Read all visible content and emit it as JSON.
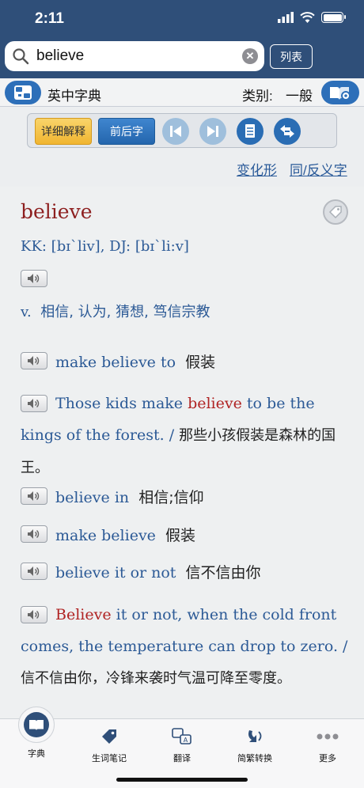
{
  "status": {
    "time": "2:11"
  },
  "search": {
    "value": "believe",
    "list_label": "列表"
  },
  "dict": {
    "title": "英中字典",
    "category_label": "类别:",
    "category_value": "一般"
  },
  "toolbar": {
    "detail_label": "详细解释",
    "nearby_label": "前后字"
  },
  "links": {
    "inflection": "变化形",
    "synonyms": "同/反义字"
  },
  "entry": {
    "headword": "believe",
    "phonetic": "KK: [bɪˋliv], DJ: [bɪˋli:v]",
    "pos": "v.",
    "definition": "相信, 认为, 猜想, 笃信宗教",
    "phrases": [
      {
        "en": "make believe to",
        "zh": "假装"
      },
      {
        "en": "believe in",
        "zh": "相信;信仰"
      },
      {
        "en": "make believe",
        "zh": "假装"
      },
      {
        "en": "believe it or not",
        "zh": "信不信由你"
      }
    ],
    "example1": {
      "pre": "Those kids make ",
      "hl": "believe",
      "post": " to be the kings of the forest. / ",
      "zh": "那些小孩假装是森林的国王。"
    },
    "example2": {
      "hl": "Believe",
      "post": " it or not, when the cold front comes, the temperature can drop to zero. / ",
      "zh": "信不信由你，冷锋来袭时气温可降至零度。"
    }
  },
  "tabs": {
    "dictionary": "字典",
    "notes": "生词笔记",
    "translate": "翻译",
    "convert": "简繁转换",
    "more": "更多"
  },
  "colors": {
    "header": "#2f4f79",
    "accent": "#2d6fb9",
    "headword": "#8d1f1f",
    "text_blue": "#2c5a96"
  }
}
